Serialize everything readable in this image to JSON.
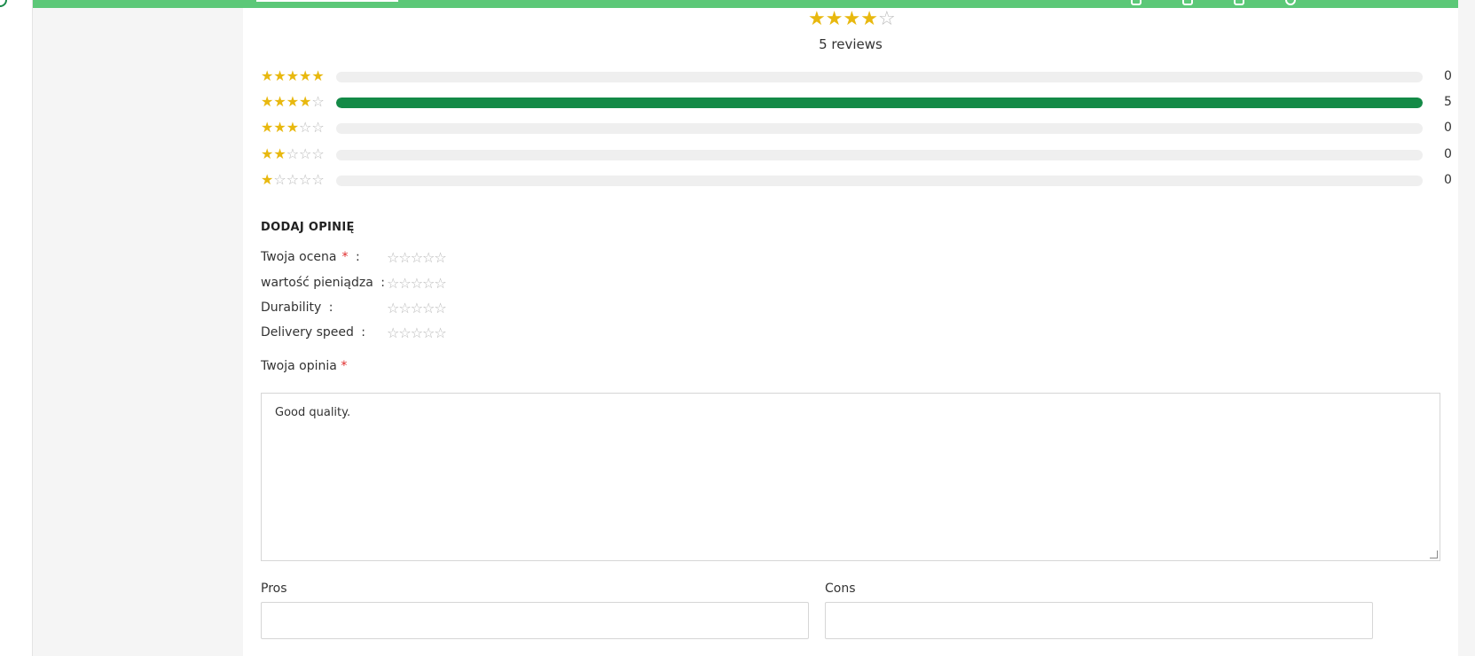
{
  "summary": {
    "rating": 4,
    "max_rating": 5,
    "reviews_text": "5 reviews"
  },
  "histogram": [
    {
      "stars": 5,
      "fraction": 0.0,
      "count": "0"
    },
    {
      "stars": 4,
      "fraction": 1.0,
      "count": "5"
    },
    {
      "stars": 3,
      "fraction": 0.0,
      "count": "0"
    },
    {
      "stars": 2,
      "fraction": 0.0,
      "count": "0"
    },
    {
      "stars": 1,
      "fraction": 0.0,
      "count": "0"
    }
  ],
  "form": {
    "title": "DODAJ OPINIĘ",
    "ratings": [
      {
        "label": "Twoja ocena",
        "required": true,
        "value": 0
      },
      {
        "label": "wartość pieniądza",
        "required": false,
        "value": 0
      },
      {
        "label": "Durability",
        "required": false,
        "value": 0
      },
      {
        "label": "Delivery speed",
        "required": false,
        "value": 0
      }
    ],
    "required_mark": "*",
    "colon": ":",
    "opinion_label": "Twoja opinia",
    "opinion_value": "Good quality.",
    "pros_label": "Pros",
    "pros_value": "",
    "cons_label": "Cons",
    "cons_value": ""
  },
  "colors": {
    "topbar": "#5cc878",
    "bar_fill": "#148a47",
    "star_full": "#e8b80e",
    "star_empty": "#b9b9b9",
    "required": "#e02b2b"
  },
  "icons": {
    "star_full": "★",
    "star_empty": "☆"
  }
}
